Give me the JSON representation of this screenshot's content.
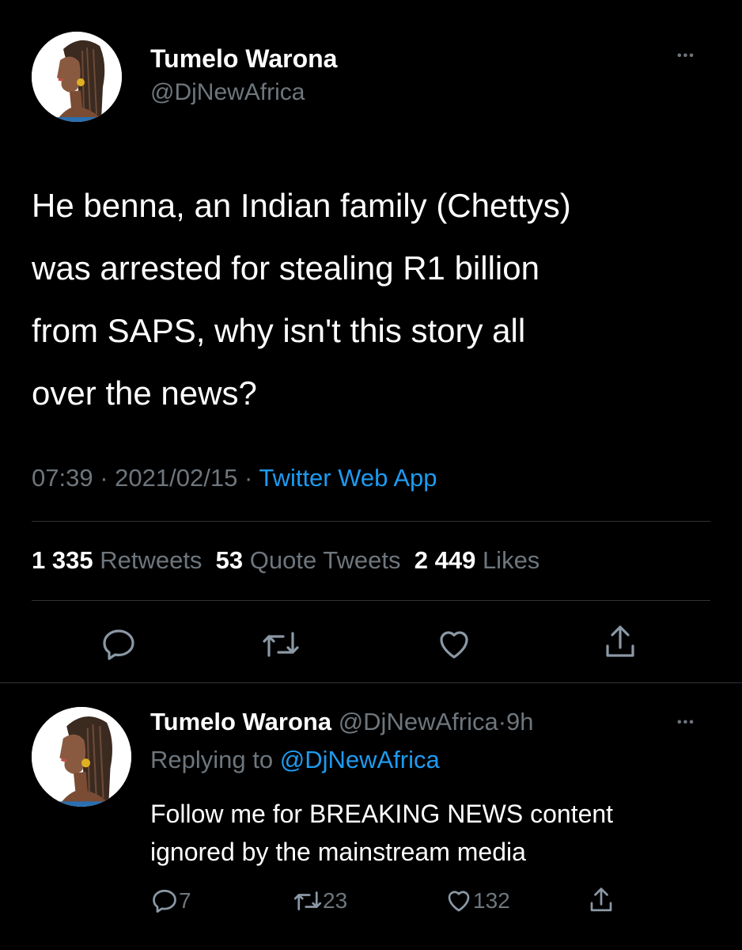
{
  "main_tweet": {
    "author": {
      "name": "Tumelo Warona",
      "handle": "@DjNewAfrica"
    },
    "more": "•••",
    "text_lines": [
      "He benna, an Indian family (Chettys)",
      "was arrested for stealing R1 billion",
      "from SAPS, why isn't this story all",
      "over the news?"
    ],
    "time": "07:39",
    "date": "2021/02/15",
    "separator": "·",
    "source": "Twitter Web App",
    "stats": {
      "retweets_count": "1 335",
      "retweets_label": "Retweets",
      "quotes_count": "53",
      "quotes_label": "Quote Tweets",
      "likes_count": "2 449",
      "likes_label": "Likes"
    },
    "actions": [
      "reply-icon",
      "retweet-icon",
      "like-icon",
      "share-icon"
    ]
  },
  "reply_tweet": {
    "author": {
      "name": "Tumelo Warona",
      "handle": "@DjNewAfrica",
      "age": "9h"
    },
    "separator": "·",
    "more": "•••",
    "replying_label": "Replying to",
    "replying_to": "@DjNewAfrica",
    "text_lines": [
      "Follow me for BREAKING NEWS content",
      "ignored by the mainstream media"
    ],
    "counts": {
      "replies": "7",
      "retweets": "23",
      "likes": "132"
    }
  },
  "colors": {
    "background": "#000000",
    "text": "#ffffff",
    "muted": "#6e767d",
    "link": "#1d9bf0",
    "divider": "#2f3336"
  }
}
